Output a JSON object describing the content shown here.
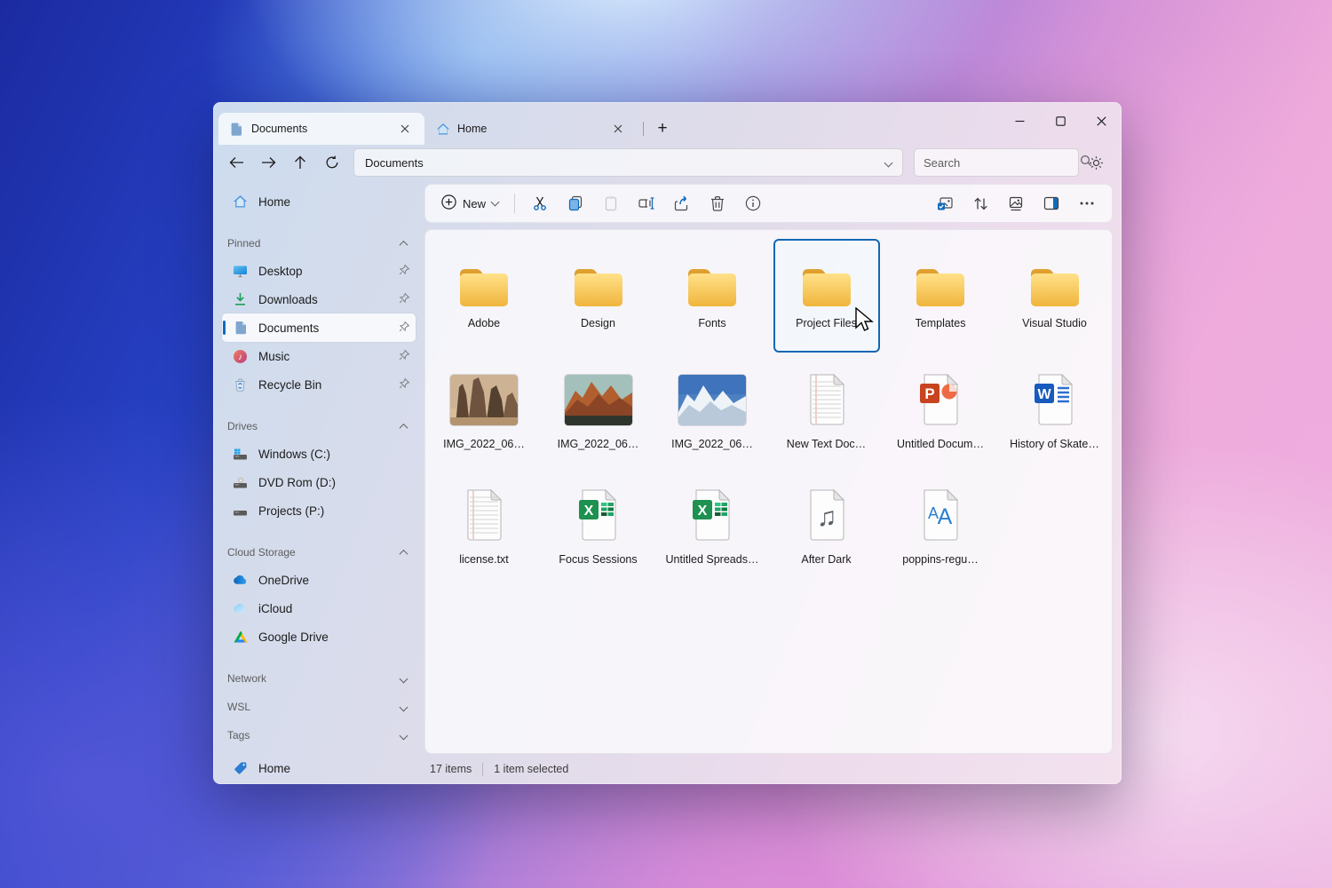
{
  "tabs": {
    "tab1": "Documents",
    "tab2": "Home"
  },
  "nav": {
    "address": "Documents",
    "search_placeholder": "Search"
  },
  "toolbar": {
    "new_label": "New"
  },
  "sidebar": {
    "home": "Home",
    "pinned": {
      "title": "Pinned",
      "items": [
        "Desktop",
        "Downloads",
        "Documents",
        "Music",
        "Recycle Bin"
      ]
    },
    "drives": {
      "title": "Drives",
      "items": [
        "Windows (C:)",
        "DVD Rom (D:)",
        "Projects (P:)"
      ]
    },
    "cloud": {
      "title": "Cloud Storage",
      "items": [
        "OneDrive",
        "iCloud",
        "Google Drive"
      ]
    },
    "network": "Network",
    "wsl": "WSL",
    "tags": "Tags",
    "tag_home": "Home"
  },
  "files": {
    "items": [
      {
        "name": "Adobe",
        "type": "folder"
      },
      {
        "name": "Design",
        "type": "folder"
      },
      {
        "name": "Fonts",
        "type": "folder"
      },
      {
        "name": "Project Files",
        "type": "folder",
        "selected": true
      },
      {
        "name": "Templates",
        "type": "folder"
      },
      {
        "name": "Visual Studio",
        "type": "folder"
      },
      {
        "name": "IMG_2022_06…",
        "type": "image"
      },
      {
        "name": "IMG_2022_06…",
        "type": "image"
      },
      {
        "name": "IMG_2022_06…",
        "type": "image"
      },
      {
        "name": "New Text Doc…",
        "type": "text"
      },
      {
        "name": "Untitled Docum…",
        "type": "powerpoint"
      },
      {
        "name": "History of Skate…",
        "type": "word"
      },
      {
        "name": "license.txt",
        "type": "text"
      },
      {
        "name": "Focus Sessions",
        "type": "excel"
      },
      {
        "name": "Untitled Spreads…",
        "type": "excel"
      },
      {
        "name": "After Dark",
        "type": "audio"
      },
      {
        "name": "poppins-regu…",
        "type": "font"
      }
    ]
  },
  "status": {
    "count": "17 items",
    "selected": "1 item selected"
  },
  "colors": {
    "accent": "#0f6cbd",
    "folder_front": "#f2b840",
    "folder_back": "#dfa02f"
  }
}
